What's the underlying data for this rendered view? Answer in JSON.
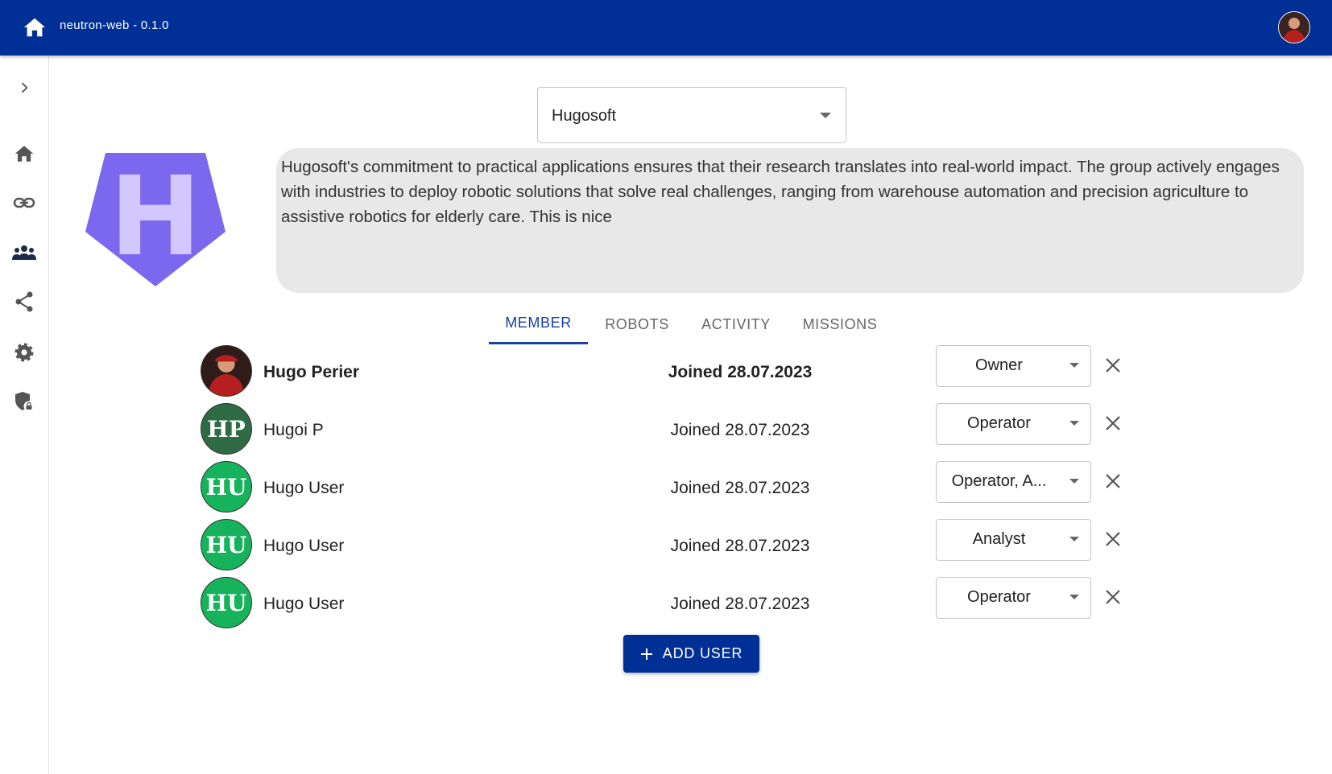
{
  "app": {
    "title": "neutron-web - 0.1.0"
  },
  "organization": {
    "selected": "Hugosoft",
    "logo_letter": "H",
    "description": "Hugosoft's commitment to practical applications ensures that their research translates into real-world impact. The group actively engages with industries to deploy robotic solutions that solve real challenges, ranging from warehouse automation and precision agriculture to assistive robotics for elderly care. This is nice"
  },
  "tabs": [
    {
      "label": "MEMBER",
      "active": true
    },
    {
      "label": "ROBOTS",
      "active": false
    },
    {
      "label": "ACTIVITY",
      "active": false
    },
    {
      "label": "MISSIONS",
      "active": false
    }
  ],
  "members": [
    {
      "initials": "",
      "name": "Hugo Perier",
      "joined": "Joined 28.07.2023",
      "role": "Owner",
      "avatar_color": "#7a2a22",
      "current_user": true
    },
    {
      "initials": "HP",
      "name": "Hugoi P",
      "joined": "Joined 28.07.2023",
      "role": "Operator",
      "avatar_color": "#2e6b45",
      "current_user": false
    },
    {
      "initials": "HU",
      "name": "Hugo User",
      "joined": "Joined 28.07.2023",
      "role": "Operator, A...",
      "avatar_color": "#16b25c",
      "current_user": false
    },
    {
      "initials": "HU",
      "name": "Hugo User",
      "joined": "Joined 28.07.2023",
      "role": "Analyst",
      "avatar_color": "#16b25c",
      "current_user": false
    },
    {
      "initials": "HU",
      "name": "Hugo User",
      "joined": "Joined 28.07.2023",
      "role": "Operator",
      "avatar_color": "#16b25c",
      "current_user": false
    }
  ],
  "actions": {
    "add_user_label": "ADD USER"
  },
  "colors": {
    "appbar": "#003096",
    "logo": "#7b68ee",
    "logo_letter": "#d2c8ff",
    "tab_active": "#1a3fa0"
  },
  "icons": {
    "sidebar": [
      "chevron-right-icon",
      "home-icon",
      "link-icon",
      "groups-icon",
      "share-icon",
      "settings-icon",
      "shield-lock-icon"
    ],
    "member_row": [
      "chevron-down-icon",
      "close-icon"
    ]
  }
}
